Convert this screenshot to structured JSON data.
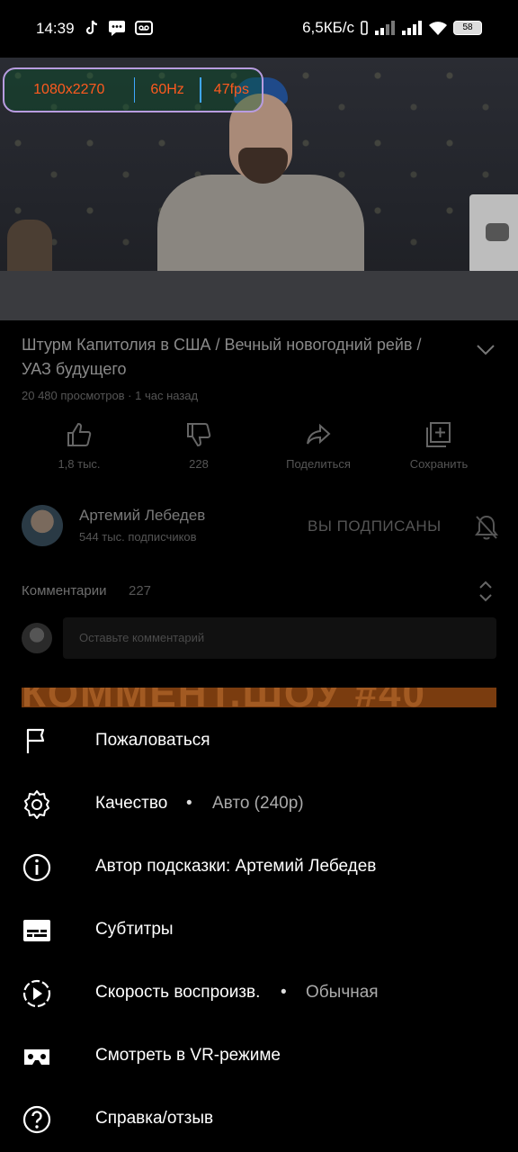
{
  "status_bar": {
    "time": "14:39",
    "network_speed": "6,5КБ/с",
    "battery": "58",
    "icons": [
      "tiktok-icon",
      "message-icon",
      "voicemail-icon",
      "vibrate-icon",
      "signal-icon",
      "signal-icon",
      "wifi-icon",
      "battery-icon"
    ]
  },
  "fps_overlay": {
    "resolution": "1080x2270",
    "refresh": "60Hz",
    "fps": "47fps"
  },
  "video": {
    "title": "Штурм Капитолия в США / Вечный новогодний рейв / УАЗ будущего",
    "meta": "20 480 просмотров · 1 час назад"
  },
  "actions": {
    "like": "1,8 тыс.",
    "dislike": "228",
    "share": "Поделиться",
    "save": "Сохранить"
  },
  "channel": {
    "name": "Артемий Лебедев",
    "subscribers": "544 тыс. подписчиков",
    "subscribed_label": "ВЫ ПОДПИСАНЫ"
  },
  "comments": {
    "header": "Комментарии",
    "count": "227",
    "placeholder": "Оставьте комментарий"
  },
  "banner_text": "КОММЕНТ.ШОУ #40",
  "menu": {
    "report": "Пожаловаться",
    "quality_label": "Качество",
    "quality_value": "Авто (240p)",
    "hint_author": "Автор подсказки: Артемий Лебедев",
    "subtitles": "Субтитры",
    "speed_label": "Скорость воспроизв.",
    "speed_value": "Обычная",
    "vr": "Смотреть в VR-режиме",
    "help": "Справка/отзыв",
    "dot": "•"
  },
  "colors": {
    "overlay_text": "#ff5a1f",
    "overlay_border": "#b89ce0",
    "overlay_separator": "#3fa7ff",
    "menu_text": "#ffffff",
    "dim_text": "#6f6f6f"
  }
}
